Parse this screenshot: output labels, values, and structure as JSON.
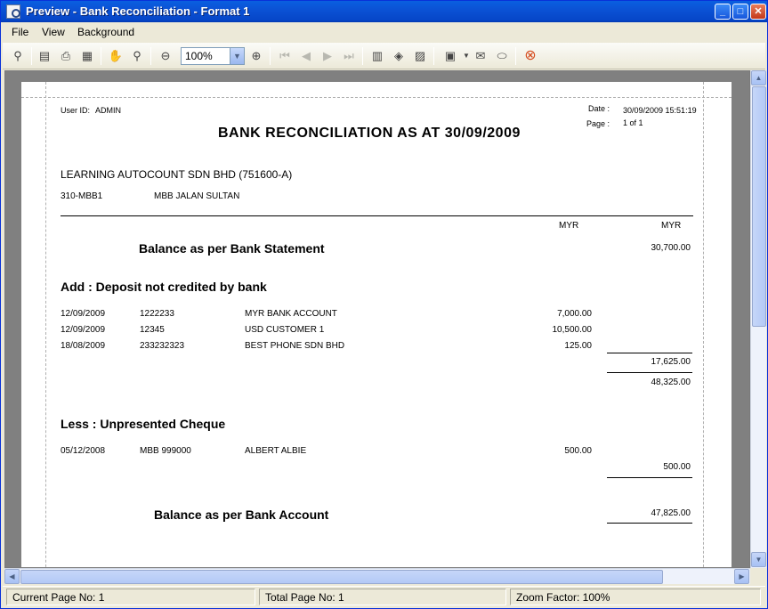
{
  "window": {
    "title": "Preview - Bank Reconciliation - Format 1"
  },
  "menu": {
    "file": "File",
    "view": "View",
    "background": "Background"
  },
  "toolbar": {
    "zoom_value": "100%"
  },
  "report": {
    "user_id_label": "User ID:",
    "user_id": "ADMIN",
    "date_label": "Date :",
    "date_value": "30/09/2009 15:51:19",
    "page_label": "Page :",
    "page_value": "1 of 1",
    "title": "BANK RECONCILIATION AS AT",
    "title_date": "30/09/2009",
    "company": "LEARNING AUTOCOUNT SDN BHD (751600-A)",
    "account_code": "310-MBB1",
    "account_name": "MBB JALAN SULTAN",
    "currency_col1": "MYR",
    "currency_col2": "MYR",
    "balance_bank_statement_label": "Balance as per Bank Statement",
    "balance_bank_statement": "30,700.00",
    "add_section_title": "Add : Deposit not credited by bank",
    "deposits": [
      {
        "date": "12/09/2009",
        "ref": "1222233",
        "desc": "MYR BANK ACCOUNT",
        "amount": "7,000.00"
      },
      {
        "date": "12/09/2009",
        "ref": "12345",
        "desc": "USD CUSTOMER 1",
        "amount": "10,500.00"
      },
      {
        "date": "18/08/2009",
        "ref": "233232323",
        "desc": "BEST PHONE SDN BHD",
        "amount": "125.00"
      }
    ],
    "deposits_total": "17,625.00",
    "subtotal": "48,325.00",
    "less_section_title": "Less : Unpresented Cheque",
    "cheques": [
      {
        "date": "05/12/2008",
        "ref": "MBB 999000",
        "desc": "ALBERT ALBIE",
        "amount": "500.00"
      }
    ],
    "cheques_total": "500.00",
    "balance_bank_account_label": "Balance as per Bank Account",
    "balance_bank_account": "47,825.00"
  },
  "status": {
    "current_page": "Current Page No: 1",
    "total_page": "Total Page No: 1",
    "zoom": "Zoom Factor: 100%"
  },
  "icons": {
    "toolbar": [
      "binoculars-icon",
      "page-setup-icon",
      "print-icon",
      "quick-print-icon",
      "hand-tool-icon",
      "magnifier-icon",
      "zoom-out-icon",
      "zoom-in-icon",
      "first-page-icon",
      "previous-page-icon",
      "next-page-icon",
      "last-page-icon",
      "multiple-pages-icon",
      "color-icon",
      "watermark-icon",
      "export-icon",
      "email-icon",
      "export-document-icon",
      "close-preview-icon"
    ]
  }
}
